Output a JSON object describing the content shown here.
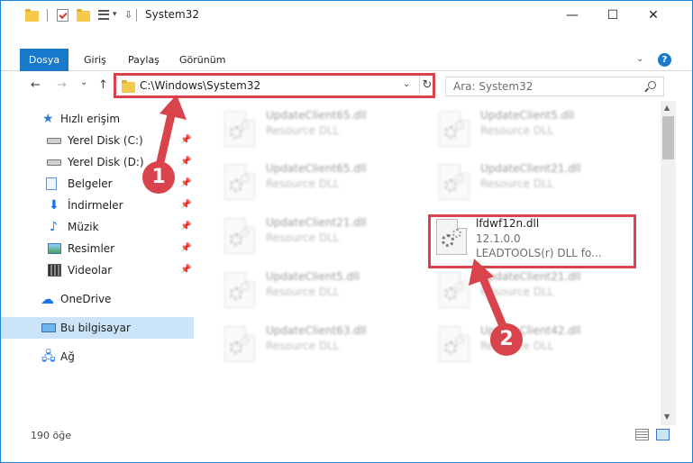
{
  "window": {
    "title": "System32",
    "accent_color": "#1979ca",
    "highlight_color": "#d9434b"
  },
  "title_bar": {
    "quick_access_icons": [
      "folder-icon",
      "properties-icon",
      "new-folder-icon",
      "view-icon"
    ],
    "controls": {
      "minimize": "—",
      "maximize": "☐",
      "close": "✕"
    }
  },
  "ribbon": {
    "file_tab": "Dosya",
    "tabs": [
      "Giriş",
      "Paylaş",
      "Görünüm"
    ]
  },
  "nav": {
    "back": "←",
    "forward": "→",
    "recent": "⌄",
    "up": "↑",
    "address": "C:\\Windows\\System32",
    "refresh": "↻",
    "search_placeholder": "Ara: System32"
  },
  "sidebar": {
    "quick_access": "Hızlı erişim",
    "items": [
      {
        "label": "Yerel Disk (C:)",
        "icon": "disk-icon",
        "pinned": true
      },
      {
        "label": "Yerel Disk (D:)",
        "icon": "disk-icon",
        "pinned": true
      },
      {
        "label": "Belgeler",
        "icon": "documents-icon",
        "pinned": true
      },
      {
        "label": "İndirmeler",
        "icon": "download-icon",
        "pinned": true
      },
      {
        "label": "Müzik",
        "icon": "music-icon",
        "pinned": true
      },
      {
        "label": "Resimler",
        "icon": "pictures-icon",
        "pinned": true
      },
      {
        "label": "Videolar",
        "icon": "videos-icon",
        "pinned": true
      }
    ],
    "onedrive": "OneDrive",
    "this_pc": "Bu bilgisayar",
    "network": "Ağ"
  },
  "files": [
    {
      "name": "UpdateClient65.dll",
      "type": "Resource DLL",
      "blurred": true
    },
    {
      "name": "UpdateClient5.dll",
      "type": "Resource DLL",
      "blurred": true
    },
    {
      "name": "UpdateClient65.dll",
      "type": "Resource DLL",
      "blurred": true
    },
    {
      "name": "UpdateClient21.dll",
      "type": "Resource DLL",
      "blurred": true
    },
    {
      "name": "UpdateClient21.dll",
      "type": "Resource DLL",
      "blurred": true
    },
    {
      "name": "lfdwf12n.dll",
      "version": "12.1.0.0",
      "type": "LEADTOOLS(r) DLL fo...",
      "blurred": false
    },
    {
      "name": "UpdateClient5.dll",
      "type": "Resource DLL",
      "blurred": true
    },
    {
      "name": "UpdateClient21.dll",
      "type": "Resource DLL",
      "blurred": true
    },
    {
      "name": "UpdateClient63.dll",
      "type": "Resource DLL",
      "blurred": true
    },
    {
      "name": "UpdateClient42.dll",
      "type": "Resource DLL",
      "blurred": true
    }
  ],
  "annotations": {
    "step1": "1",
    "step2": "2"
  },
  "status": {
    "item_count": "190 öğe"
  }
}
